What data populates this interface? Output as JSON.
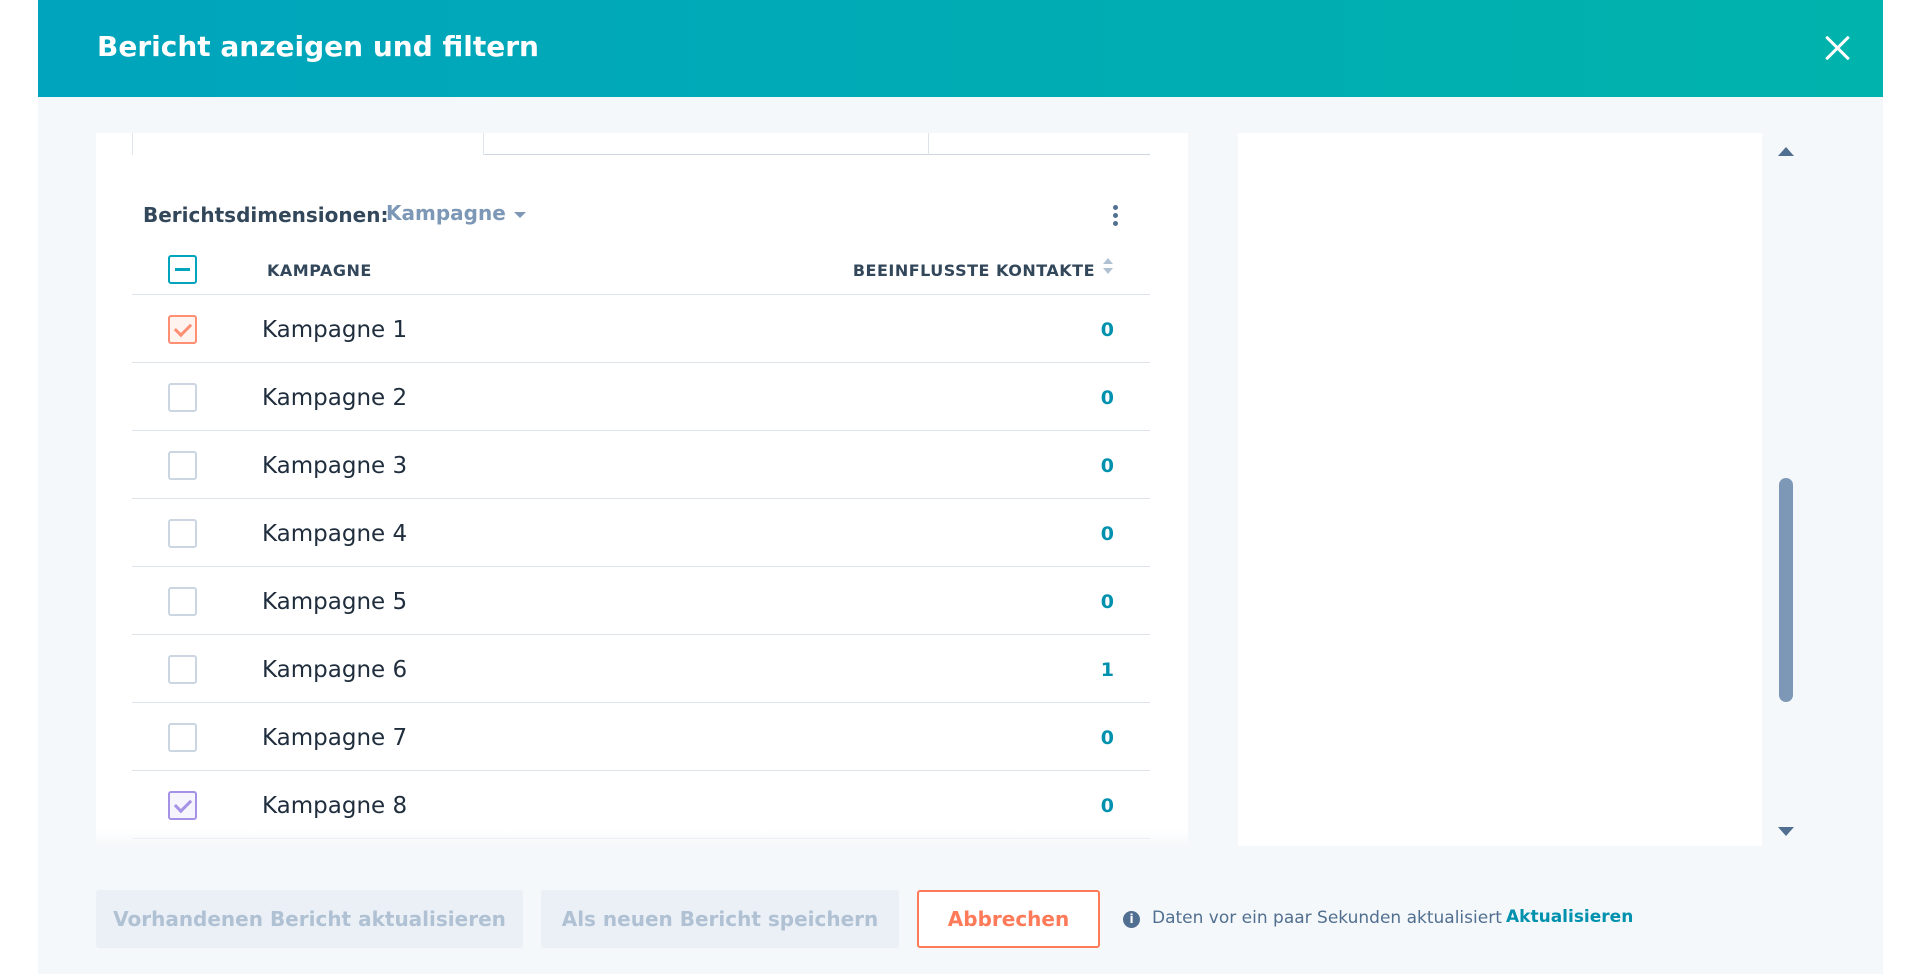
{
  "dialog": {
    "title": "Bericht anzeigen und filtern"
  },
  "report": {
    "dimensions_label": "Berichtsdimensionen:",
    "dimension_value": "Kampagne"
  },
  "table": {
    "columns": [
      "KAMPAGNE",
      "BEEINFLUSSTE KONTAKTE"
    ],
    "rows": [
      {
        "name": "Kampagne 1",
        "value": "0",
        "checked": true,
        "color": "#ff8f73"
      },
      {
        "name": "Kampagne 2",
        "value": "0",
        "checked": false
      },
      {
        "name": "Kampagne 3",
        "value": "0",
        "checked": false
      },
      {
        "name": "Kampagne 4",
        "value": "0",
        "checked": false
      },
      {
        "name": "Kampagne 5",
        "value": "0",
        "checked": false
      },
      {
        "name": "Kampagne 6",
        "value": "1",
        "checked": false
      },
      {
        "name": "Kampagne 7",
        "value": "0",
        "checked": false
      },
      {
        "name": "Kampagne 8",
        "value": "0",
        "checked": true,
        "color": "#a592e6"
      }
    ]
  },
  "footer": {
    "update_existing_label": "Vorhandenen Bericht aktualisieren",
    "save_new_label": "Als neuen Bericht speichern",
    "cancel_label": "Abbrechen",
    "info_text": "Daten vor ein paar Sekunden aktualisiert",
    "refresh_label": "Aktualisieren"
  },
  "colors": {
    "header_gradient_start": "#00a4bd",
    "header_gradient_end": "#00b3ac",
    "link": "#0091ae",
    "cancel": "#ff7a59"
  },
  "icons": {
    "close": "close-icon",
    "kebab": "kebab-menu-icon",
    "sort": "sort-icon",
    "info": "info-icon"
  }
}
